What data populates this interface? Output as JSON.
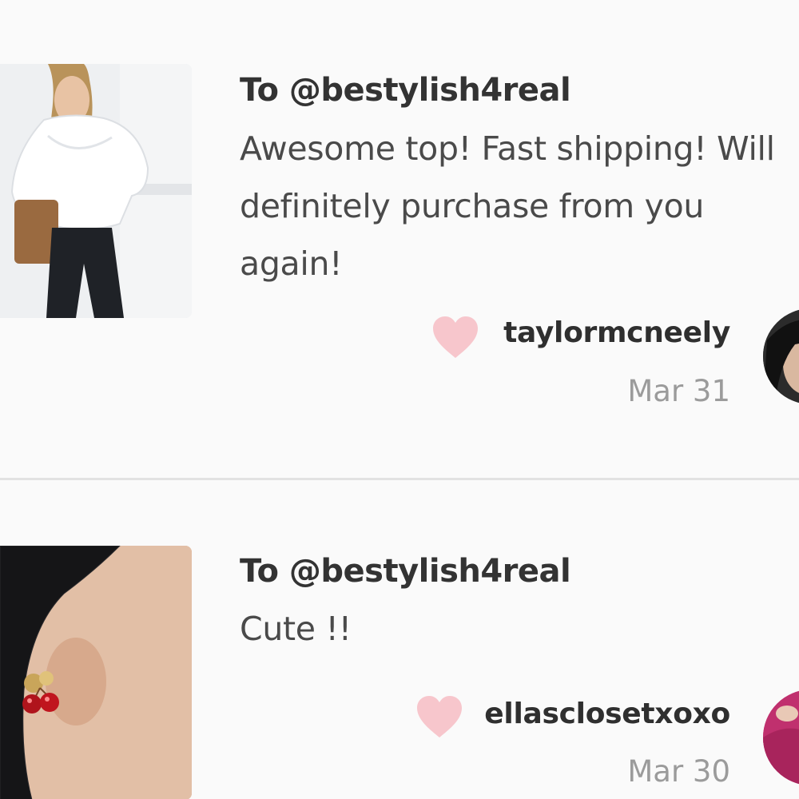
{
  "reviews": [
    {
      "recipient": "To @bestylish4real",
      "body": "Awesome top! Fast shipping! Will definitely purchase from you again!",
      "username": "taylormcneely",
      "date": "Mar 31",
      "product_image": "off-shoulder white top photo",
      "avatar": "user avatar"
    },
    {
      "recipient": "To @bestylish4real",
      "body": "Cute !!",
      "username": "ellasclosetxoxo",
      "date": "Mar 30",
      "product_image": "cherry earrings photo",
      "avatar": "user avatar"
    }
  ],
  "colors": {
    "heart": "#f7c6cc",
    "background": "#fafafa",
    "divider": "#e2e2e2",
    "date": "#9b9b9b"
  }
}
